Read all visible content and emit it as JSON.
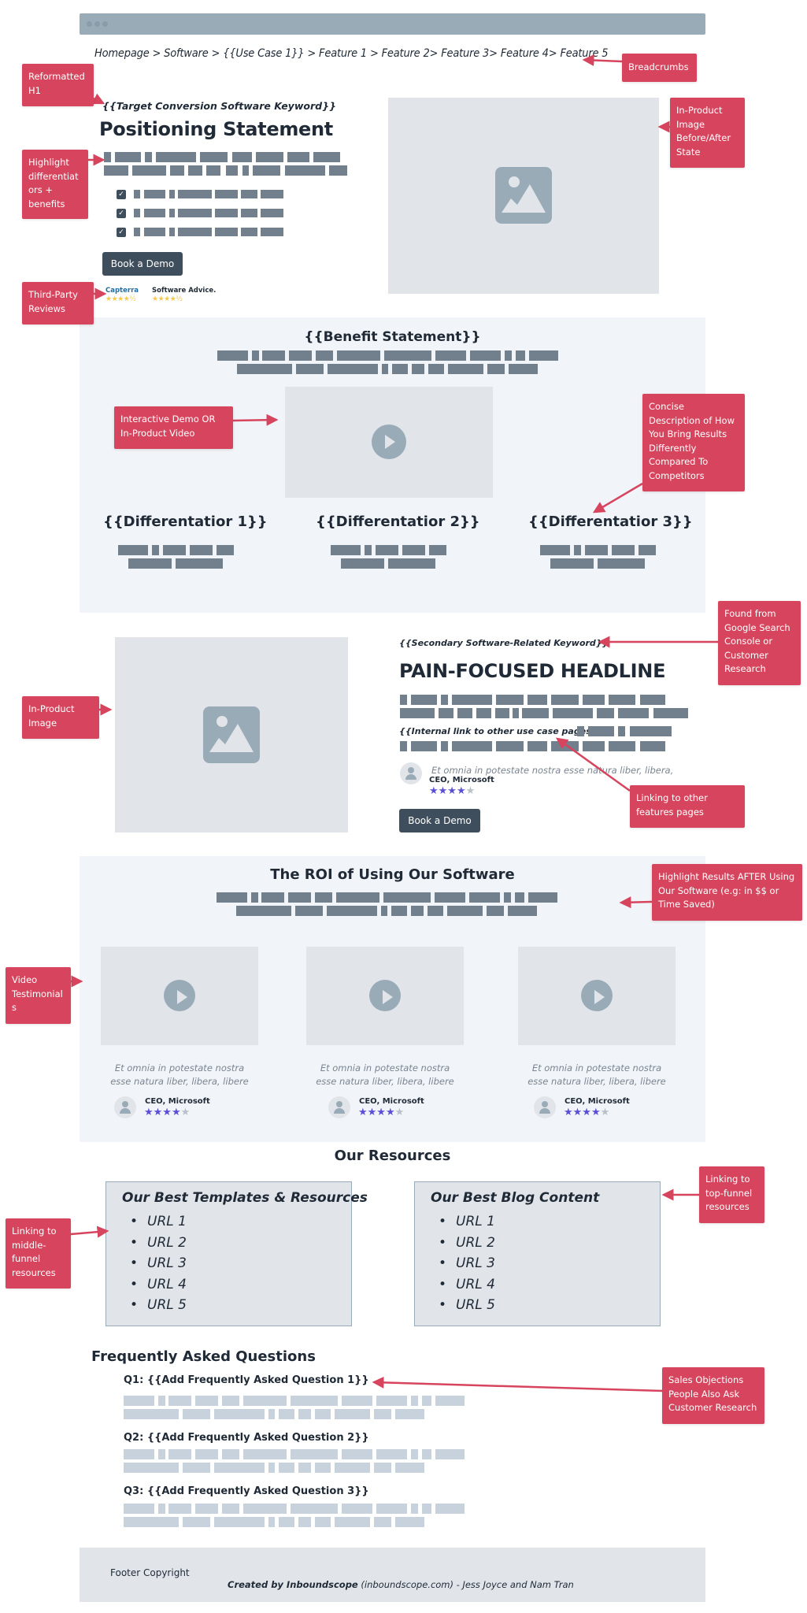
{
  "breadcrumb": "Homepage > Software > {{Use Case 1}} > Feature 1 > Feature 2> Feature 3> Feature 4> Feature 5",
  "hero": {
    "keyword": "{{Target Conversion Software Keyword}}",
    "title": "Positioning Statement",
    "cta_label": "Book a Demo",
    "checklist_count": 3,
    "reviews": [
      {
        "name": "Capterra",
        "rating": 4.5
      },
      {
        "name": "Software Advice.",
        "rating": 4.5
      }
    ]
  },
  "benefit": {
    "title": "{{Benefit Statement}}",
    "differentiators": [
      "{{Differentatior 1}}",
      "{{Differentatior 2}}",
      "{{Differentatior 3}}"
    ]
  },
  "pain": {
    "keyword": "{{Secondary Software-Related Keyword}}",
    "title": "PAIN-FOCUSED HEADLINE",
    "internal_link": "{{Internal link to other use case pages}}",
    "testimonial_quote": "Et omnia in potestate nostra esse natura liber, libera,",
    "testimonial_author": "CEO, Microsoft",
    "testimonial_rating": 4,
    "cta_label": "Book a Demo"
  },
  "roi": {
    "title": "The ROI of Using Our Software",
    "testimonials": [
      {
        "quote_line1": "Et omnia in potestate nostra",
        "quote_line2": "esse natura liber, libera, libere",
        "author": "CEO, Microsoft",
        "rating": 4
      },
      {
        "quote_line1": "Et omnia in potestate nostra",
        "quote_line2": "esse natura liber, libera, libere",
        "author": "CEO, Microsoft",
        "rating": 4
      },
      {
        "quote_line1": "Et omnia in potestate nostra",
        "quote_line2": "esse natura liber, libera, libere",
        "author": "CEO, Microsoft",
        "rating": 4
      }
    ]
  },
  "resources": {
    "title": "Our Resources",
    "boxes": [
      {
        "title": "Our Best Templates & Resources",
        "items": [
          "URL 1",
          "URL 2",
          "URL 3",
          "URL 4",
          "URL 5"
        ]
      },
      {
        "title": "Our Best Blog Content",
        "items": [
          "URL 1",
          "URL 2",
          "URL 3",
          "URL 4",
          "URL 5"
        ]
      }
    ]
  },
  "faq": {
    "title": "Frequently Asked Questions",
    "questions": [
      "Q1: {{Add Frequently Asked Question 1}}",
      "Q2: {{Add Frequently Asked Question 2}}",
      "Q3: {{Add Frequently Asked Question 3}}"
    ]
  },
  "footer": {
    "copyright": "Footer Copyright",
    "credit_bold": "Created by Inboundscope",
    "credit_rest": " (inboundscope.com) - Jess Joyce and Nam Tran"
  },
  "annotations": {
    "reformatted_h1": "Reformatted H1",
    "breadcrumbs": "Breadcrumbs",
    "highlight": "Highlight differentiat ors + benefits",
    "in_product_before_after": "In-Product Image Before/After State",
    "third_party": "Third-Party Reviews",
    "interactive_demo": "Interactive Demo OR In-Product Video",
    "concise": "Concise Description of How You Bring Results Differently Compared To Competitors",
    "found_from": "Found from Google Search Console or Customer Research",
    "in_product": "In-Product Image",
    "linking_features": "Linking to other features pages",
    "highlight_results": "Highlight Results AFTER Using Our Software (e.g: in $$ or Time Saved)",
    "video_testimonials": "Video Testimonial s",
    "linking_top": "Linking to top-funnel resources",
    "linking_middle": "Linking to middle-funnel resources",
    "sales_objections": "Sales Objections People Also Ask Customer Research"
  },
  "colors": {
    "annotation": "#d6455d",
    "star_active": "#5b4fd6",
    "placeholder_bar": "#72808e",
    "button": "#3f4e5c"
  }
}
